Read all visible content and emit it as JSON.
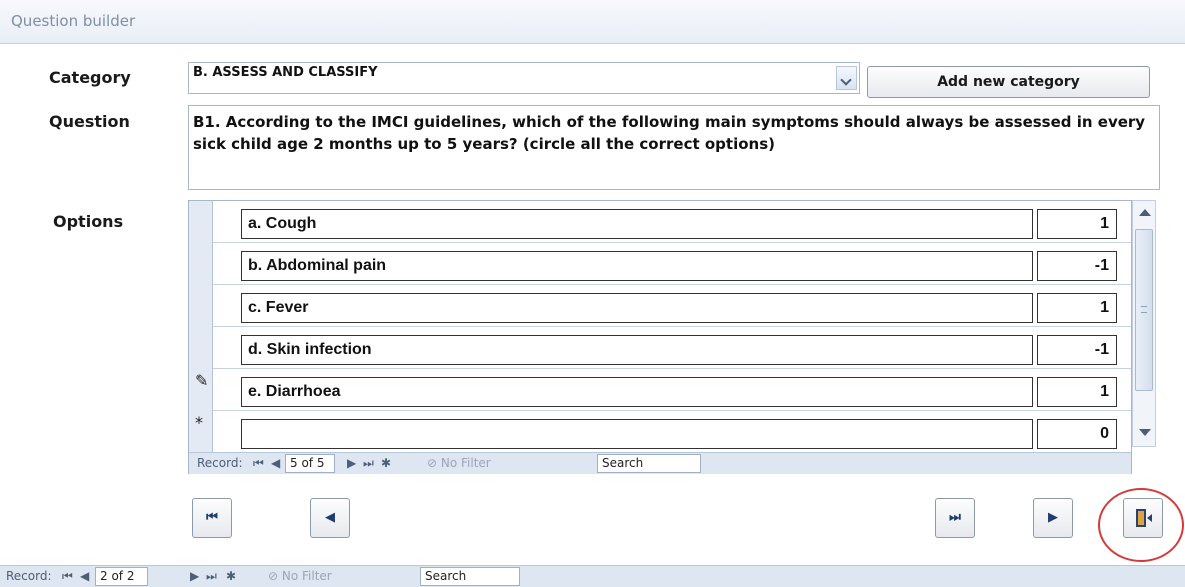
{
  "window": {
    "title": "Question builder"
  },
  "form": {
    "category_label": "Category",
    "category_value": "B. ASSESS AND CLASSIFY",
    "add_category_button": "Add new category",
    "question_label": "Question",
    "question_text": "B1. According to the IMCI guidelines, which of the following main symptoms should always be assessed in every sick child age 2 months up to 5 years? (circle all the correct options)",
    "options_label": "Options"
  },
  "options": [
    {
      "text": "a. Cough",
      "score": "1",
      "selector": ""
    },
    {
      "text": "b. Abdominal pain",
      "score": "-1",
      "selector": ""
    },
    {
      "text": "c. Fever",
      "score": "1",
      "selector": ""
    },
    {
      "text": "d. Skin infection",
      "score": "-1",
      "selector": ""
    },
    {
      "text": "e. Diarrhoea",
      "score": "1",
      "selector": "pencil-icon"
    },
    {
      "text": "",
      "score": "0",
      "selector": "new-record-icon"
    }
  ],
  "subform_nav": {
    "record_label": "Record:",
    "position": "5 of 5",
    "filter": "No Filter",
    "search": "Search"
  },
  "main_nav": {
    "record_label": "Record:",
    "position": "2 of 2",
    "filter": "No Filter",
    "search": "Search"
  },
  "icons": {
    "first": "first-record-icon",
    "prev": "previous-record-icon",
    "last": "last-record-icon",
    "next": "next-record-icon",
    "exit": "exit-door-icon"
  },
  "colors": {
    "highlight": "#d43a3a",
    "accent": "#1f3c73"
  }
}
